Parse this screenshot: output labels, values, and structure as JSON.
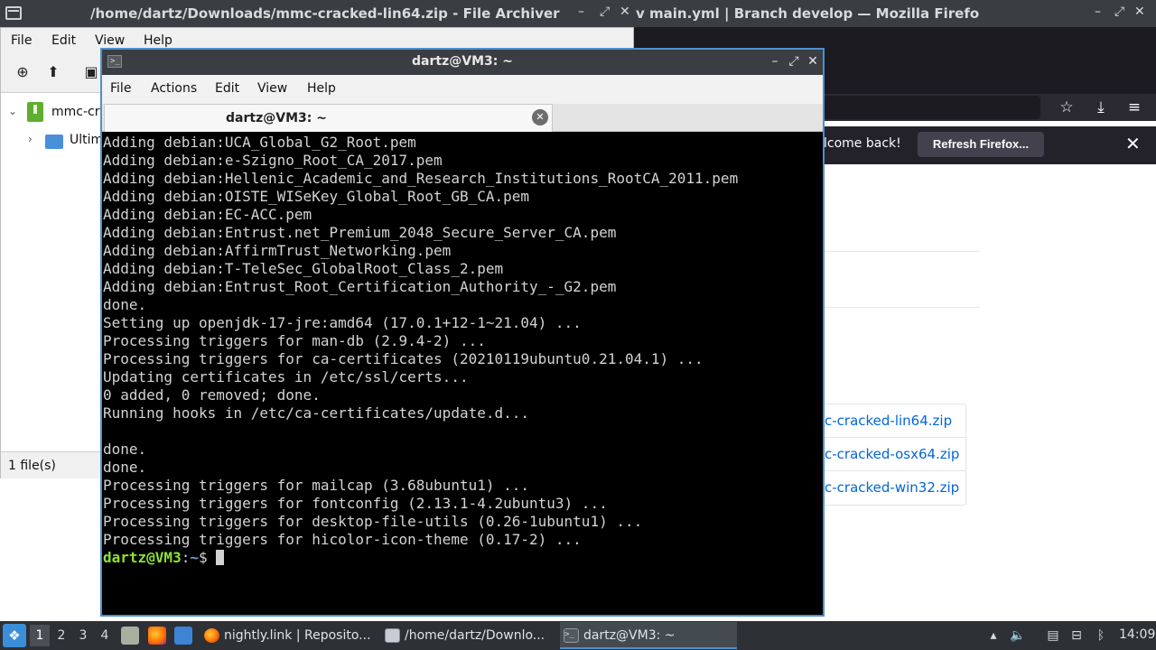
{
  "background_titlebar": {
    "archiver_title": "/home/dartz/Downloads/mmc-cracked-lin64.zip - File Archiver",
    "firefox_title": "v main.yml | Branch develop — Mozilla Firefox"
  },
  "archiver": {
    "menu": [
      "File",
      "Edit",
      "View",
      "Help"
    ],
    "tree": {
      "root_label": "mmc-cra",
      "child_label": "Ultim"
    },
    "status": "1 file(s)"
  },
  "firefox": {
    "notice_text": "lcome back!",
    "refresh_button": "Refresh Firefox...",
    "files": [
      "c-cracked-lin64.zip",
      "c-cracked-osx64.zip",
      "c-cracked-win32.zip"
    ],
    "link_color": "#0366d6"
  },
  "terminal": {
    "title": "dartz@VM3: ~",
    "menu": [
      "File",
      "Actions",
      "Edit",
      "View",
      "Help"
    ],
    "tab_label": "dartz@VM3: ~",
    "lines": [
      "Adding debian:UCA_Global_G2_Root.pem",
      "Adding debian:e-Szigno_Root_CA_2017.pem",
      "Adding debian:Hellenic_Academic_and_Research_Institutions_RootCA_2011.pem",
      "Adding debian:OISTE_WISeKey_Global_Root_GB_CA.pem",
      "Adding debian:EC-ACC.pem",
      "Adding debian:Entrust.net_Premium_2048_Secure_Server_CA.pem",
      "Adding debian:AffirmTrust_Networking.pem",
      "Adding debian:T-TeleSec_GlobalRoot_Class_2.pem",
      "Adding debian:Entrust_Root_Certification_Authority_-_G2.pem",
      "done.",
      "Setting up openjdk-17-jre:amd64 (17.0.1+12-1~21.04) ...",
      "Processing triggers for man-db (2.9.4-2) ...",
      "Processing triggers for ca-certificates (20210119ubuntu0.21.04.1) ...",
      "Updating certificates in /etc/ssl/certs...",
      "0 added, 0 removed; done.",
      "Running hooks in /etc/ca-certificates/update.d...",
      "",
      "done.",
      "done.",
      "Processing triggers for mailcap (3.68ubuntu1) ...",
      "Processing triggers for fontconfig (2.13.1-4.2ubuntu3) ...",
      "Processing triggers for desktop-file-utils (0.26-1ubuntu1) ...",
      "Processing triggers for hicolor-icon-theme (0.17-2) ..."
    ],
    "prompt": {
      "user": "dartz@VM3",
      "sep": ":",
      "path": "~",
      "sign": "$ "
    },
    "colors": {
      "prompt_user": "#8ae234",
      "prompt_path": "#729fcf",
      "text": "#d3d3d3",
      "border": "#4f8fcf"
    }
  },
  "taskbar": {
    "workspaces": [
      "1",
      "2",
      "3",
      "4"
    ],
    "active_workspace": "1",
    "tasks": [
      {
        "label": "nightly.link | Reposito...",
        "icon": "firefox-icon"
      },
      {
        "label": "/home/dartz/Downlo...",
        "icon": "archive-icon"
      },
      {
        "label": "dartz@VM3: ~",
        "icon": "terminal-icon"
      }
    ],
    "clock": "14:09"
  }
}
